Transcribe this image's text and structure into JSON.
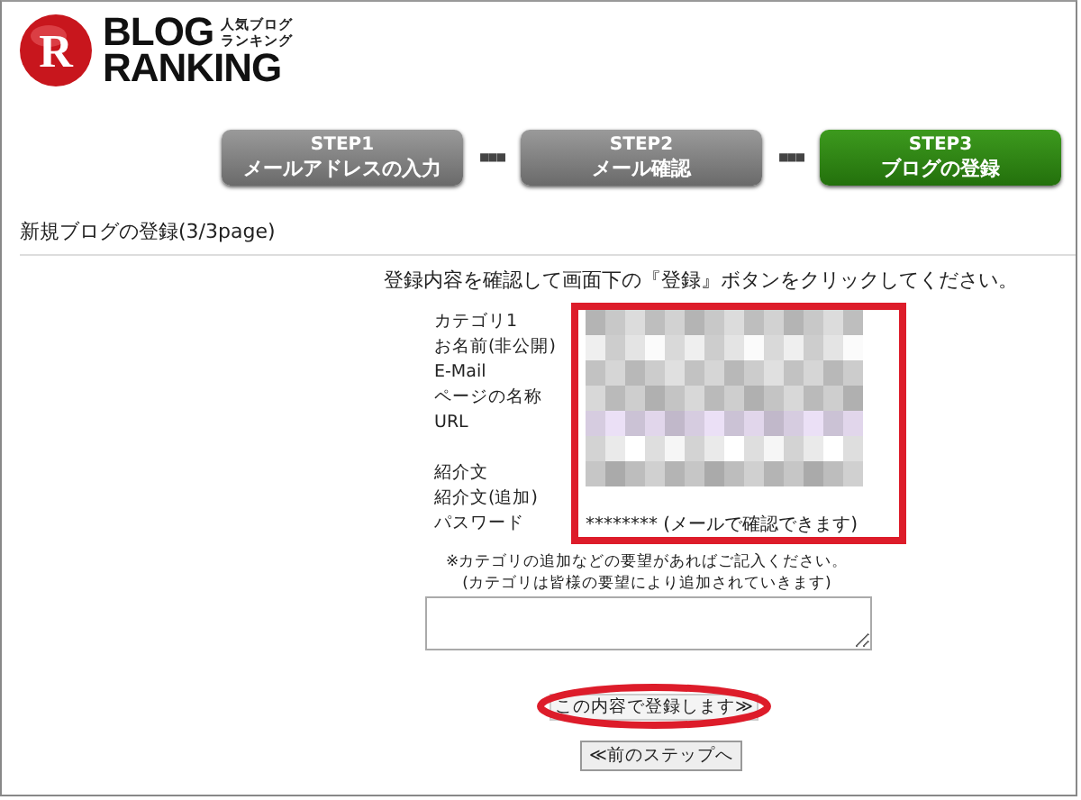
{
  "logo": {
    "mark": "R",
    "word_top": "BLOG",
    "word_bottom": "RANKING",
    "tagline": [
      "人気ブログ",
      "ランキング"
    ]
  },
  "steps": [
    {
      "step": "STEP1",
      "label": "メールアドレスの入力",
      "selected": false
    },
    {
      "step": "STEP2",
      "label": "メール確認",
      "selected": false
    },
    {
      "step": "STEP3",
      "label": "ブログの登録",
      "selected": true
    }
  ],
  "step_separator": "■■■",
  "heading": "新規ブログの登録(3/3page)",
  "instruction": "登録内容を確認して画面下の『登録』ボタンをクリックしてください。",
  "details": [
    {
      "label": "カテゴリ1",
      "kind": "masked",
      "color": "#c8c8c8"
    },
    {
      "label": "お名前(非公開)",
      "kind": "masked",
      "color": "#e4e4e4"
    },
    {
      "label": "E-Mail",
      "kind": "masked",
      "color": "#cccccc"
    },
    {
      "label": "ページの名称",
      "kind": "masked",
      "color": "#c4c4c4"
    },
    {
      "label": "URL",
      "kind": "masked",
      "color": "#d6cce0"
    },
    {
      "kind": "masked",
      "color": "#eaeaea"
    },
    {
      "label": "紹介文",
      "kind": "masked",
      "color": "#bdbdbd"
    },
    {
      "label": "紹介文(追加)",
      "kind": "empty"
    },
    {
      "label": "パスワード",
      "kind": "text",
      "value": "******** (メールで確認できます)"
    }
  ],
  "note": [
    "※カテゴリの追加などの要望があればご記入ください。",
    "(カテゴリは皆様の要望により追加されていきます)"
  ],
  "submit_button": "この内容で登録します≫",
  "back_button": "≪前のステップへ"
}
